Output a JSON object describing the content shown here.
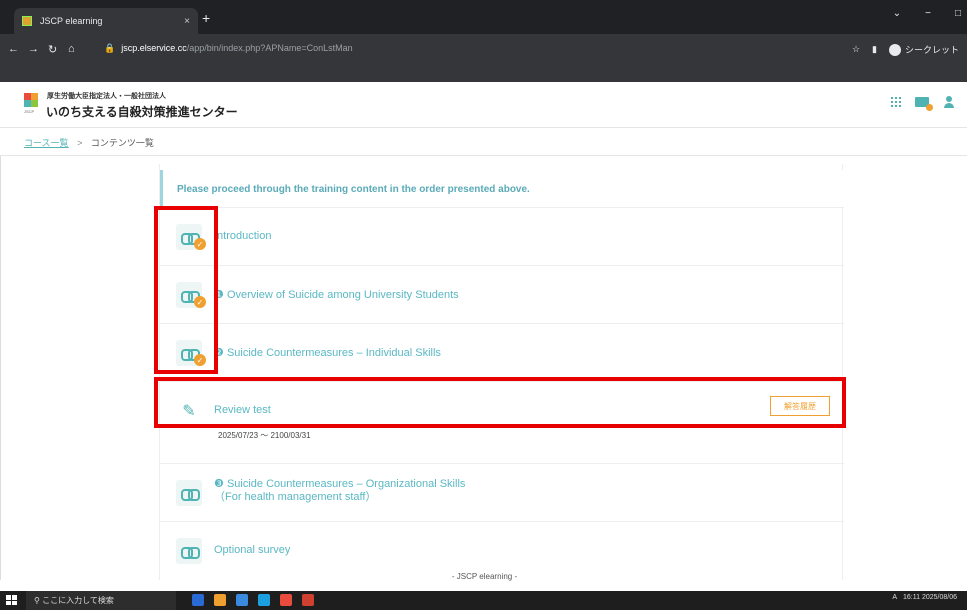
{
  "browser": {
    "tab_title": "JSCP elearning",
    "tab_close": "×",
    "new_tab": "+",
    "url_host": "jscp.elservice.cc",
    "url_path": "/app/bin/index.php?APName=ConLstMan",
    "incognito_label": "シークレット",
    "window_controls": [
      "⌄",
      "−",
      "□"
    ]
  },
  "header": {
    "org": "厚生労働大臣指定法人・一般社団法人",
    "title": "いのち支える自殺対策推進センター",
    "logo_caption": "JSCP",
    "logo_colors": [
      "#e94b3c",
      "#f0a030",
      "#4fb3b3",
      "#8cc63f"
    ]
  },
  "breadcrumb": {
    "course_list": "コース一覧",
    "separator": ">",
    "current": "コンテンツ一覧"
  },
  "content": {
    "notice": "Please proceed through the training content in the order presented above.",
    "items": [
      {
        "label": "Introduction",
        "icon": "link-icon",
        "completed": true
      },
      {
        "num": "❶",
        "label": "Overview of Suicide among University Students",
        "icon": "link-icon",
        "completed": true
      },
      {
        "num": "❷",
        "label": "Suicide Countermeasures – Individual Skills",
        "icon": "link-icon",
        "completed": true
      },
      {
        "label": "Review test",
        "icon": "pencil-icon",
        "button": "解答履歴",
        "period": "2025/07/23 ～ 2100/03/31"
      },
      {
        "num": "❸",
        "label": "Suicide Countermeasures – Organizational Skills",
        "label2": "（For health management staff）",
        "icon": "link-icon"
      },
      {
        "label": "Optional survey",
        "icon": "link-icon"
      }
    ],
    "footer": "- JSCP elearning -"
  },
  "taskbar": {
    "search_placeholder": "ここに入力して検索",
    "time": "16:11",
    "date": "2025/08/06",
    "ime": "A"
  },
  "colors": {
    "accent": "#4fb3b3",
    "orange": "#f0a030",
    "highlight": "#e80000"
  }
}
